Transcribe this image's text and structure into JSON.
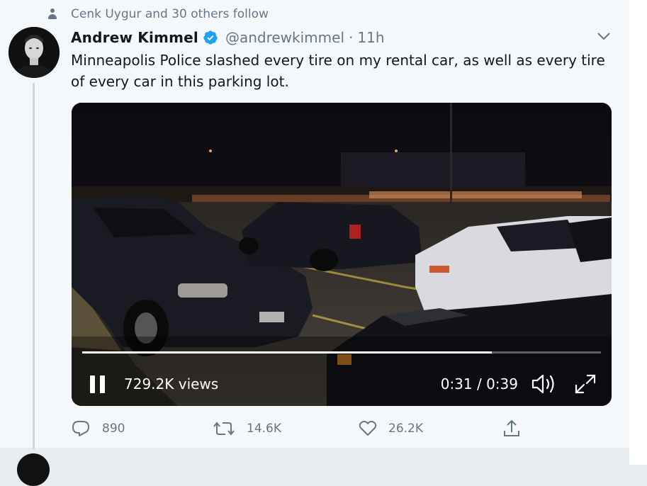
{
  "social_context": {
    "text": "Cenk Uygur and 30 others follow",
    "icon": "person-icon"
  },
  "tweet": {
    "author_name": "Andrew Kimmel",
    "handle": "@andrewkimmel",
    "separator": "·",
    "time": "11h",
    "verified": true,
    "text": "Minneapolis Police slashed every tire on my rental car, as well as every tire of every car in this parking lot."
  },
  "video": {
    "views": "729.2K views",
    "time": "0:31 / 0:39",
    "progress": 0.79,
    "state": "playing"
  },
  "actions": {
    "reply_count": "890",
    "retweet_count": "14.6K",
    "like_count": "26.2K"
  },
  "colors": {
    "accent": "#1da1f2",
    "muted": "#657786",
    "text": "#14171a",
    "thread_line": "#ccd6dd"
  }
}
